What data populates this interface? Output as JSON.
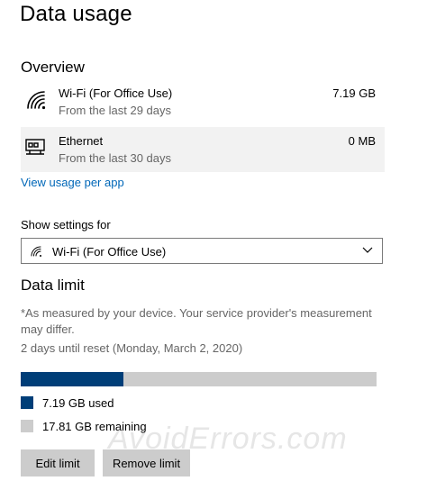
{
  "page": {
    "title": "Data usage"
  },
  "overview": {
    "title": "Overview",
    "networks": [
      {
        "name": "Wi-Fi (For Office Use)",
        "period": "From the last 29 days",
        "amount": "7.19 GB",
        "icon": "wifi-icon"
      },
      {
        "name": "Ethernet",
        "period": "From the last 30 days",
        "amount": "0 MB",
        "icon": "ethernet-icon"
      }
    ],
    "link_label": "View usage per app"
  },
  "settings": {
    "label": "Show settings for",
    "selected": "Wi-Fi (For Office Use)"
  },
  "data_limit": {
    "title": "Data limit",
    "note": "*As measured by your device. Your service provider's measurement may differ.",
    "reset_text": "2 days until reset (Monday, March 2, 2020)",
    "used_fraction": 0.288,
    "used_label": "7.19 GB used",
    "remaining_label": "17.81 GB remaining",
    "used_color": "#003e78",
    "remaining_color": "#cccccc",
    "edit_label": "Edit limit",
    "remove_label": "Remove limit"
  },
  "watermark": "AvoidErrors.com"
}
